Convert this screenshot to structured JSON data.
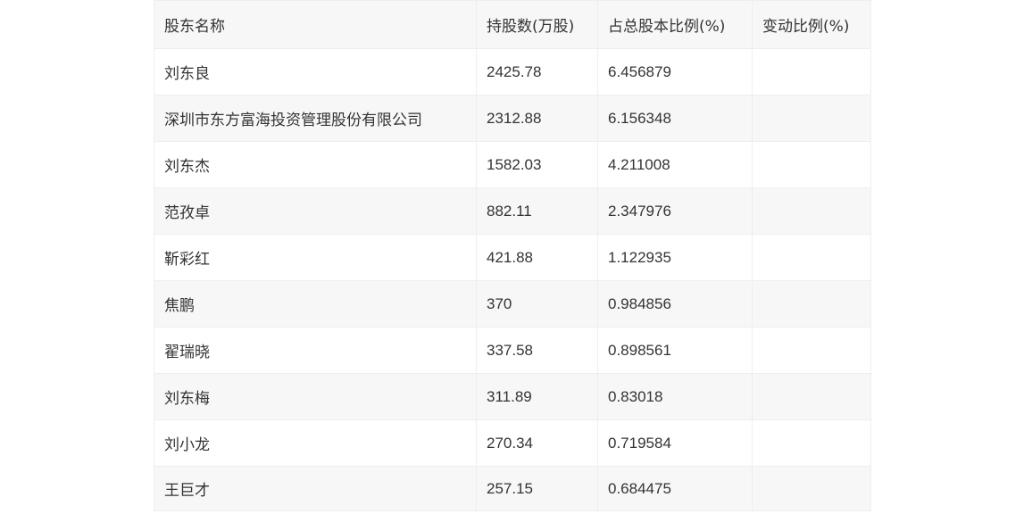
{
  "table": {
    "headers": [
      "股东名称",
      "持股数(万股)",
      "占总股本比例(%)",
      "变动比例(%)"
    ],
    "rows": [
      {
        "name": "刘东良",
        "shares": "2425.78",
        "ratio": "6.456879",
        "change": ""
      },
      {
        "name": "深圳市东方富海投资管理股份有限公司",
        "shares": "2312.88",
        "ratio": "6.156348",
        "change": ""
      },
      {
        "name": "刘东杰",
        "shares": "1582.03",
        "ratio": "4.211008",
        "change": ""
      },
      {
        "name": "范孜卓",
        "shares": "882.11",
        "ratio": "2.347976",
        "change": ""
      },
      {
        "name": "靳彩红",
        "shares": "421.88",
        "ratio": "1.122935",
        "change": ""
      },
      {
        "name": "焦鹏",
        "shares": "370",
        "ratio": "0.984856",
        "change": ""
      },
      {
        "name": "翟瑞晓",
        "shares": "337.58",
        "ratio": "0.898561",
        "change": ""
      },
      {
        "name": "刘东梅",
        "shares": "311.89",
        "ratio": "0.83018",
        "change": ""
      },
      {
        "name": "刘小龙",
        "shares": "270.34",
        "ratio": "0.719584",
        "change": ""
      },
      {
        "name": "王巨才",
        "shares": "257.15",
        "ratio": "0.684475",
        "change": ""
      }
    ]
  }
}
